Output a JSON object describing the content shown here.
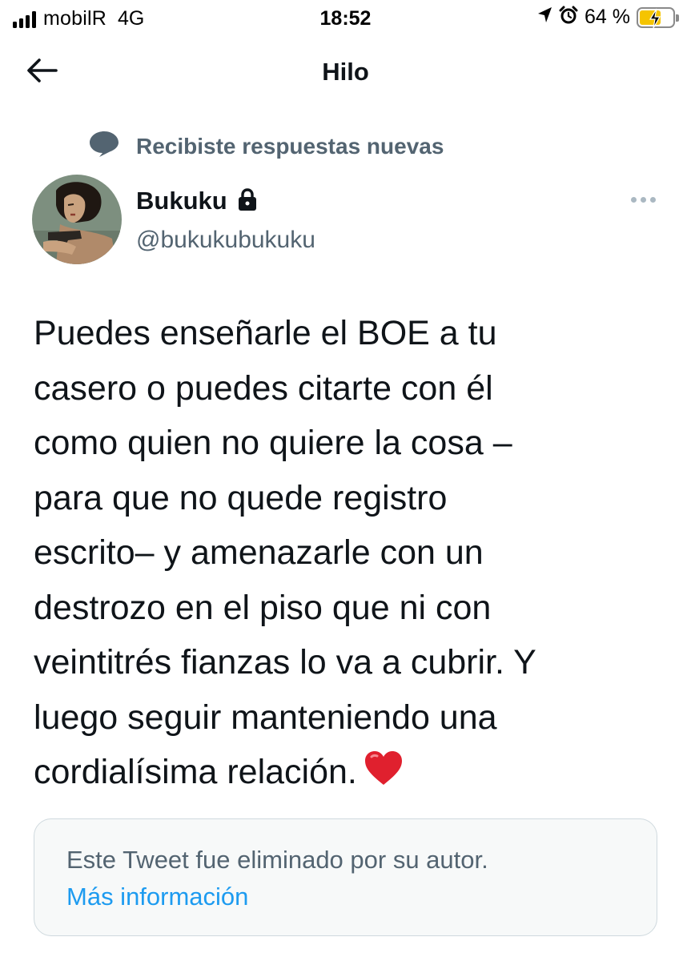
{
  "status_bar": {
    "carrier": "mobilR",
    "network": "4G",
    "time": "18:52",
    "battery_percent": "64 %",
    "battery_level": 0.64,
    "icons": [
      "signal-bars-icon",
      "location-arrow-icon",
      "alarm-clock-icon",
      "battery-charging-icon"
    ]
  },
  "nav": {
    "title": "Hilo",
    "back_icon": "arrow-left-icon"
  },
  "context": {
    "label": "Recibiste respuestas nuevas",
    "icon": "speech-bubble-icon"
  },
  "tweet": {
    "author_name": "Bukuku",
    "author_handle": "@bukukubukuku",
    "protected_icon": "lock-icon",
    "more_icon": "more-dots-icon",
    "text_lines": [
      "Puedes enseñarle el BOE a tu",
      "casero o puedes citarte con él",
      "como quien no quiere la cosa –",
      "para que no quede registro",
      "escrito– y amenazarle con un",
      "destrozo en el piso que ni con",
      "veintitrés fianzas lo va a cubrir. Y",
      "luego seguir manteniendo una",
      "cordialísima relación."
    ],
    "emoji_icon": "red-heart-icon"
  },
  "deleted_notice": {
    "text": "Este Tweet fue eliminado por su autor.",
    "link": "Más información"
  },
  "colors": {
    "primary_text": "#0f1419",
    "secondary_text": "#536471",
    "link": "#1d9bf0",
    "notice_bg": "#f7f9f9",
    "notice_border": "#cfd9de",
    "battery_fill": "#f5c400"
  }
}
